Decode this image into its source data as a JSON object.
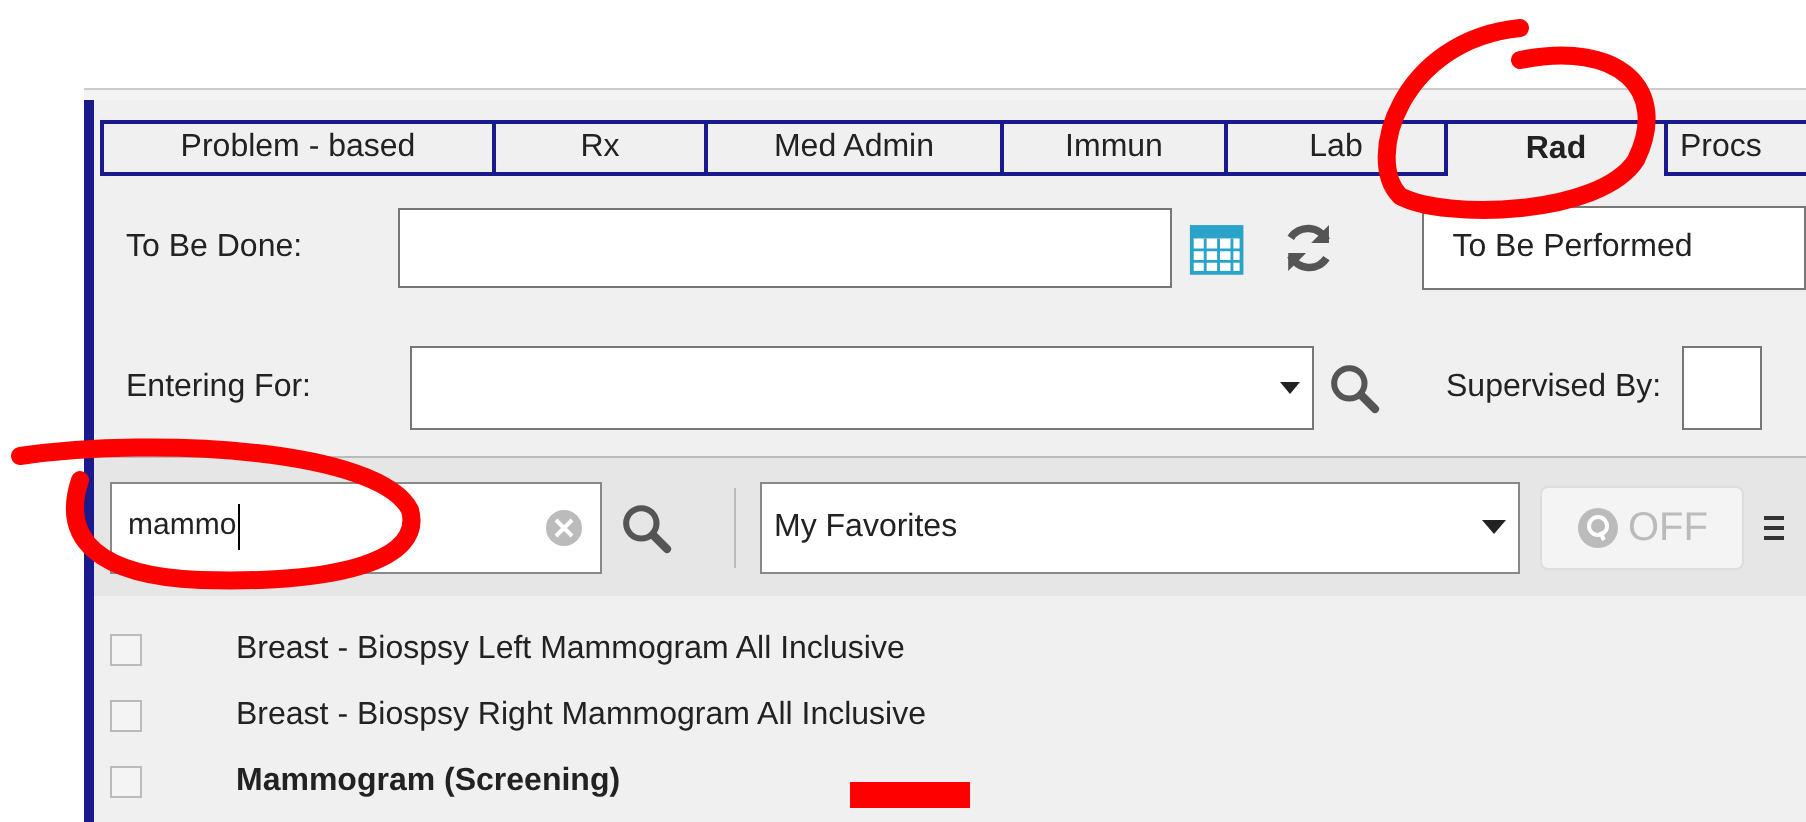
{
  "tabs": [
    {
      "label": "Problem - based",
      "selected": false
    },
    {
      "label": "Rx",
      "selected": false
    },
    {
      "label": "Med Admin",
      "selected": false
    },
    {
      "label": "Immun",
      "selected": false
    },
    {
      "label": "Lab",
      "selected": false
    },
    {
      "label": "Rad",
      "selected": true
    },
    {
      "label": "Procs",
      "selected": false
    }
  ],
  "to_be_done": {
    "label": "To Be Done:",
    "status": "To Be Performed"
  },
  "entering_for": {
    "label": "Entering For:"
  },
  "supervised_by": {
    "label": "Supervised By:"
  },
  "search": {
    "value": "mammo"
  },
  "favorites": {
    "value": "My Favorites"
  },
  "filter_toggle": {
    "label": "OFF",
    "on": false
  },
  "orders": [
    {
      "name": "Breast - Biospsy Left Mammogram All Inclusive",
      "checked": false,
      "bold": false
    },
    {
      "name": "Breast - Biospsy Right Mammogram All Inclusive",
      "checked": false,
      "bold": false
    },
    {
      "name": "Mammogram (Screening)",
      "checked": false,
      "bold": true
    }
  ]
}
